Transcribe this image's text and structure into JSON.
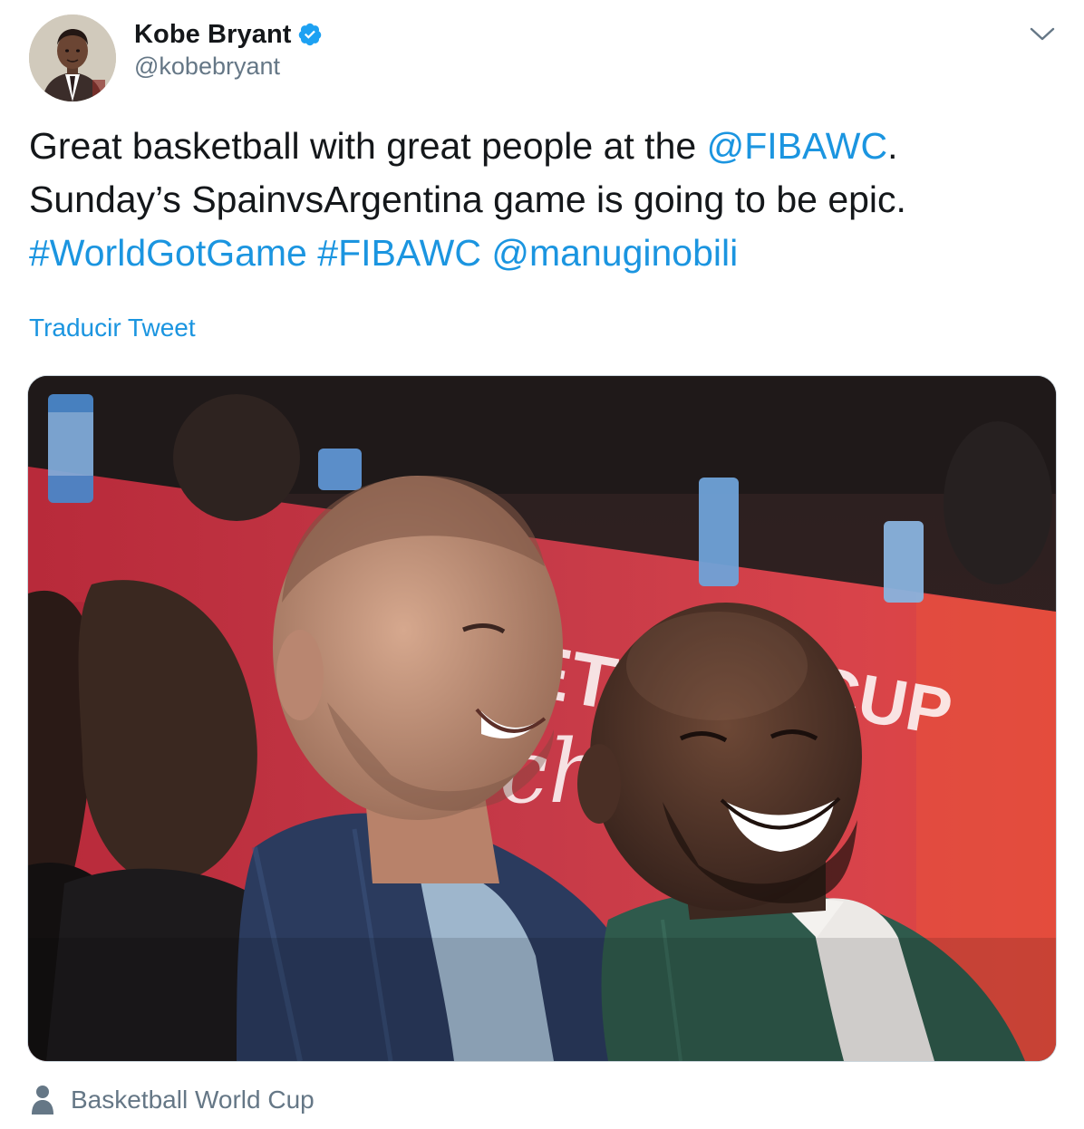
{
  "user": {
    "display_name": "Kobe Bryant",
    "handle": "@kobebryant",
    "verified": true
  },
  "tweet": {
    "line1": {
      "text_before": "Great basketball with great people at the ",
      "mention": "@FIBAWC",
      "text_after": "."
    },
    "line2": {
      "text": "Sunday’s SpainvsArgentina game is going to be epic."
    },
    "line3": {
      "hashtag1": "#WorldGotGame",
      "hashtag2": "#FIBAWC",
      "mention": "@manuginobili"
    }
  },
  "translate_label": "Traducir Tweet",
  "location": {
    "label": "Basketball World Cup"
  },
  "colors": {
    "link": "#1b95e0",
    "secondary_text": "#657786",
    "primary_text": "#14171a",
    "border": "#ccd6dd",
    "verified_badge": "#1da1f2"
  },
  "icons": {
    "verified": "verified-badge-icon",
    "more": "chevron-down-icon",
    "location": "person-icon"
  }
}
